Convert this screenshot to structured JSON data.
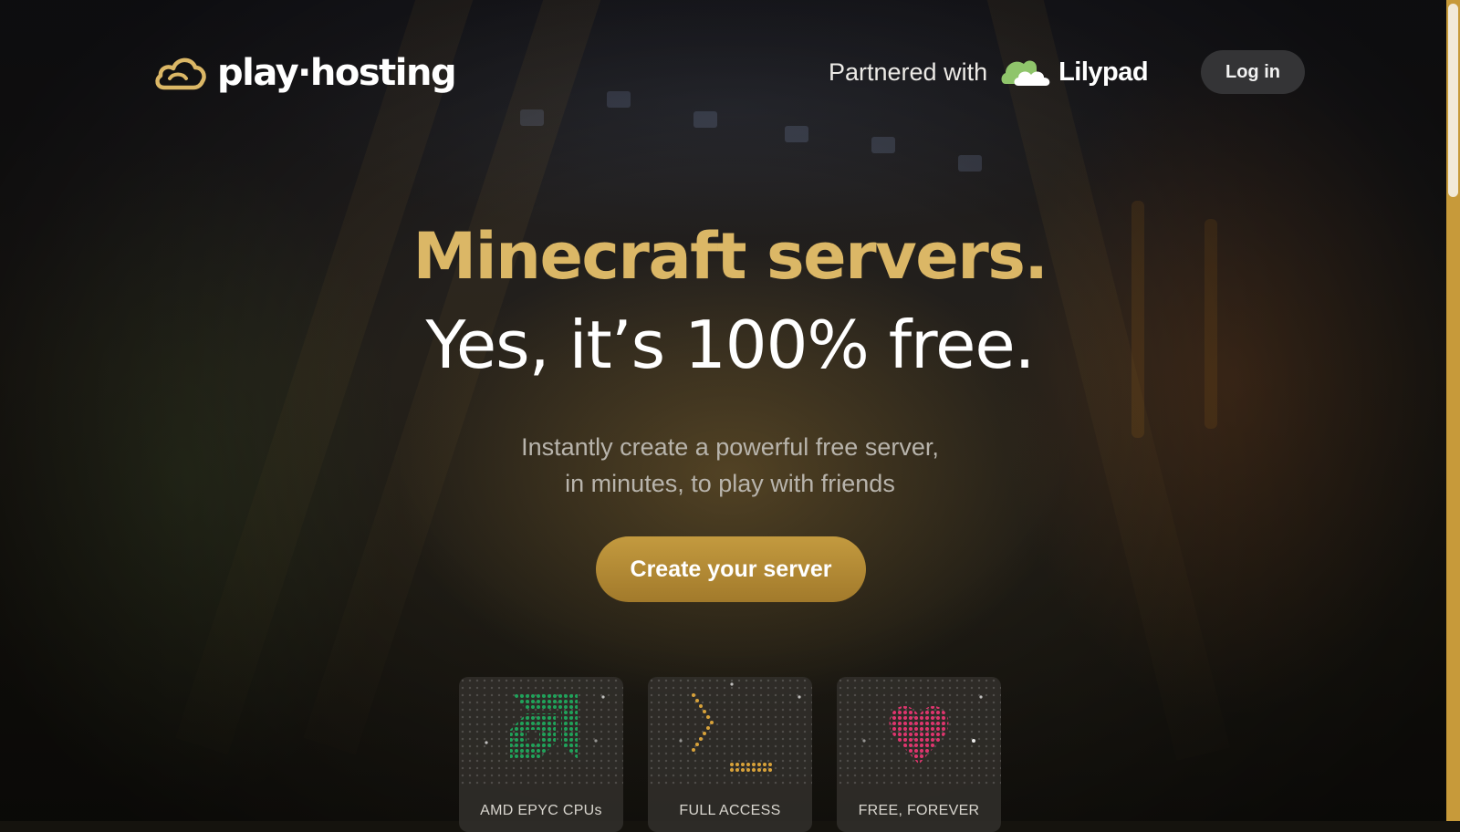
{
  "header": {
    "brand_name": "play·hosting",
    "partner_label": "Partnered with",
    "partner_name": "Lilypad",
    "login_label": "Log in"
  },
  "hero": {
    "headline_1": "Minecraft servers.",
    "headline_2": "Yes, it’s 100% free.",
    "subtitle_line_1": "Instantly create a powerful free server,",
    "subtitle_line_2": "in minutes, to play with friends",
    "cta_label": "Create your server"
  },
  "features": [
    {
      "label": "AMD EPYC CPUs",
      "icon": "amd-logo-icon",
      "color": "#1fa35a"
    },
    {
      "label": "FULL ACCESS",
      "icon": "terminal-prompt-icon",
      "color": "#d8a23a"
    },
    {
      "label": "FREE, FOREVER",
      "icon": "heart-icon",
      "color": "#e0356e"
    }
  ],
  "colors": {
    "accent_gold": "#dbb766",
    "cta_gold": "#b48a35",
    "scrollbar": "#c79a3a"
  }
}
